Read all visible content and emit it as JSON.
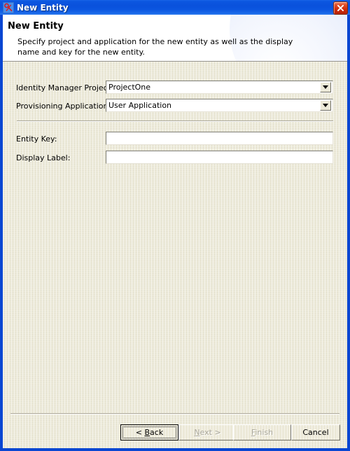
{
  "window": {
    "title": "New Entity",
    "icon": "entity-icon",
    "close_label": "Close",
    "close_icon": "close-icon",
    "accent_color": "#0a51dc",
    "body_color": "#ece9d8",
    "close_button_color": "#cf2b0a"
  },
  "header": {
    "title": "New Entity",
    "description": "Specify project and application for the new entity as well as the display name and key for the new entity."
  },
  "form": {
    "fields": [
      {
        "label": "Identity Manager Project:",
        "type": "combo",
        "value": "ProjectOne",
        "arrow_icon": "chevron-down-icon"
      },
      {
        "label": "Provisioning Application:",
        "type": "combo",
        "value": "User Application",
        "arrow_icon": "chevron-down-icon"
      },
      {
        "label": "Entity Key:",
        "type": "text",
        "value": "",
        "placeholder": ""
      },
      {
        "label": "Display Label:",
        "type": "text",
        "value": "",
        "placeholder": ""
      }
    ]
  },
  "buttons": {
    "back": {
      "label": "< Back",
      "mnemonic_prefix": "< ",
      "mnemonic": "B",
      "mnemonic_suffix": "ack",
      "enabled": true,
      "default": true
    },
    "next": {
      "label": "Next >",
      "mnemonic_prefix": "",
      "mnemonic": "N",
      "mnemonic_suffix": "ext >",
      "enabled": false,
      "default": false
    },
    "finish": {
      "label": "Finish",
      "mnemonic_prefix": "",
      "mnemonic": "F",
      "mnemonic_suffix": "inish",
      "enabled": false,
      "default": false
    },
    "cancel": {
      "label": "Cancel",
      "mnemonic_prefix": "",
      "mnemonic": "",
      "mnemonic_suffix": "",
      "enabled": true,
      "default": false
    }
  }
}
